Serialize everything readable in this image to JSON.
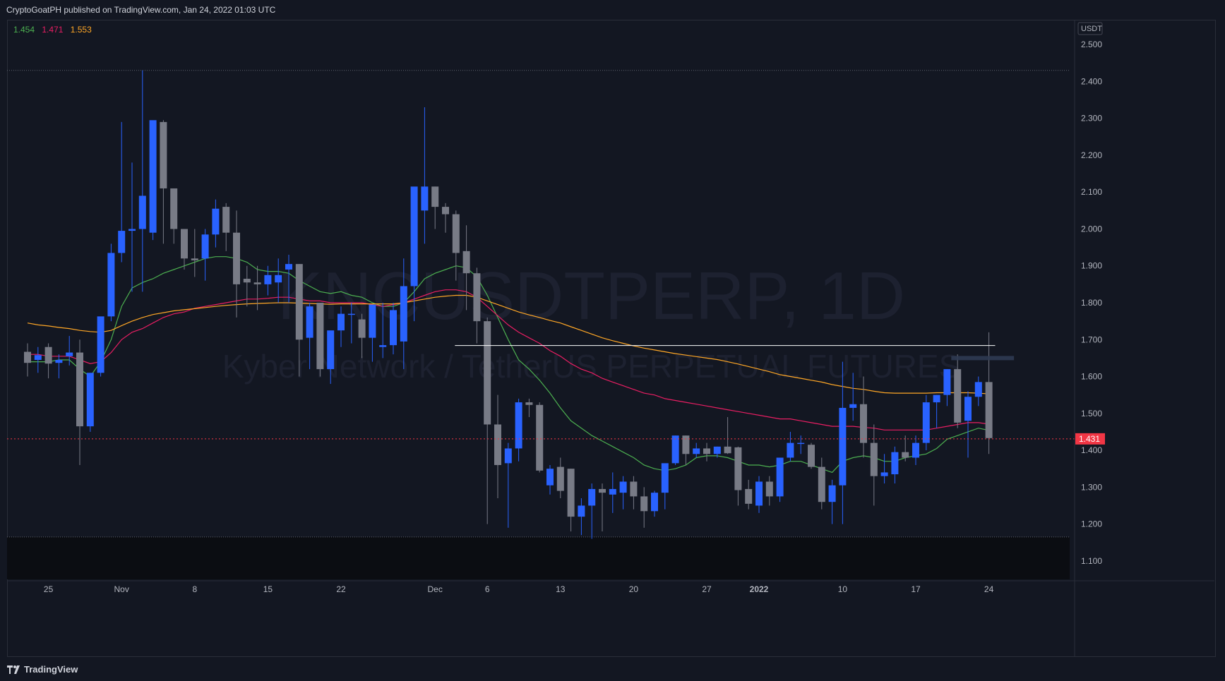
{
  "header": {
    "published_text": "CryptoGoatPH published on TradingView.com, Jan 24, 2022 01:03 UTC"
  },
  "footer": {
    "logo_text": "TradingView"
  },
  "legend": {
    "ma_fast": {
      "value": "1.454",
      "color": "#4caf50"
    },
    "ma_mid": {
      "value": "1.471",
      "color": "#e91e63"
    },
    "ma_slow": {
      "value": "1.553",
      "color": "#ffa726"
    }
  },
  "watermark": {
    "symbol": "KNCUSDTPERP, 1D",
    "description": "Kyber Network / TetherUS PERPETUAL FUTURES"
  },
  "price_axis": {
    "currency": "USDT",
    "last_price": "1.431"
  },
  "colors": {
    "up": "#2962ff",
    "down": "#787b86",
    "last_price_line": "#f23645",
    "background": "#131722"
  },
  "chart_data": {
    "type": "candlestick",
    "symbol": "KNCUSDTPERP",
    "interval": "1D",
    "ylim": [
      1.05,
      2.55
    ],
    "y_ticks": [
      "2.500",
      "2.400",
      "2.300",
      "2.200",
      "2.100",
      "2.000",
      "1.900",
      "1.800",
      "1.700",
      "1.600",
      "1.500",
      "1.400",
      "1.300",
      "1.200",
      "1.100"
    ],
    "x_ticks": [
      {
        "label": "25",
        "index": 2
      },
      {
        "label": "Nov",
        "index": 9
      },
      {
        "label": "8",
        "index": 16
      },
      {
        "label": "15",
        "index": 23
      },
      {
        "label": "22",
        "index": 30
      },
      {
        "label": "Dec",
        "index": 39
      },
      {
        "label": "6",
        "index": 44
      },
      {
        "label": "13",
        "index": 51
      },
      {
        "label": "20",
        "index": 58
      },
      {
        "label": "27",
        "index": 65
      },
      {
        "label": "2022",
        "index": 70
      },
      {
        "label": "10",
        "index": 78
      },
      {
        "label": "17",
        "index": 85
      },
      {
        "label": "24",
        "index": 92
      }
    ],
    "candles": [
      [
        1.667,
        1.69,
        1.6,
        1.637
      ],
      [
        1.645,
        1.68,
        1.61,
        1.658
      ],
      [
        1.68,
        1.69,
        1.595,
        1.635
      ],
      [
        1.637,
        1.66,
        1.595,
        1.645
      ],
      [
        1.655,
        1.71,
        1.63,
        1.665
      ],
      [
        1.665,
        1.7,
        1.36,
        1.465
      ],
      [
        1.465,
        1.61,
        1.45,
        1.61
      ],
      [
        1.61,
        1.71,
        1.6,
        1.763
      ],
      [
        1.763,
        1.96,
        1.75,
        1.935
      ],
      [
        1.935,
        2.29,
        1.91,
        1.995
      ],
      [
        1.995,
        2.18,
        1.83,
        2.0
      ],
      [
        2.0,
        2.43,
        1.83,
        2.09
      ],
      [
        1.99,
        2.29,
        1.97,
        2.295
      ],
      [
        2.29,
        2.295,
        1.96,
        2.11
      ],
      [
        2.11,
        2.11,
        1.96,
        2.0
      ],
      [
        2.0,
        2.0,
        1.89,
        1.92
      ],
      [
        1.92,
        2.0,
        1.87,
        1.915
      ],
      [
        1.92,
        2.0,
        1.86,
        1.985
      ],
      [
        1.985,
        2.08,
        1.95,
        2.055
      ],
      [
        2.06,
        2.07,
        1.94,
        1.99
      ],
      [
        1.99,
        2.05,
        1.76,
        1.85
      ],
      [
        1.865,
        1.9,
        1.79,
        1.855
      ],
      [
        1.855,
        1.9,
        1.78,
        1.85
      ],
      [
        1.85,
        1.9,
        1.82,
        1.875
      ],
      [
        1.855,
        1.92,
        1.8,
        1.875
      ],
      [
        1.89,
        1.93,
        1.8,
        1.905
      ],
      [
        1.905,
        1.905,
        1.6,
        1.7
      ],
      [
        1.705,
        1.8,
        1.62,
        1.79
      ],
      [
        1.8,
        1.8,
        1.6,
        1.62
      ],
      [
        1.62,
        1.72,
        1.58,
        1.725
      ],
      [
        1.725,
        1.79,
        1.68,
        1.77
      ],
      [
        1.77,
        1.8,
        1.69,
        1.77
      ],
      [
        1.755,
        1.77,
        1.65,
        1.705
      ],
      [
        1.705,
        1.76,
        1.64,
        1.795
      ],
      [
        1.68,
        1.8,
        1.65,
        1.685
      ],
      [
        1.685,
        1.8,
        1.66,
        1.78
      ],
      [
        1.695,
        1.92,
        1.62,
        1.845
      ],
      [
        1.845,
        2.1,
        1.75,
        2.115
      ],
      [
        2.05,
        2.33,
        1.96,
        2.115
      ],
      [
        2.115,
        2.115,
        2.0,
        2.06
      ],
      [
        2.06,
        2.07,
        1.99,
        2.04
      ],
      [
        2.04,
        2.05,
        1.86,
        1.935
      ],
      [
        1.94,
        2.01,
        1.78,
        1.88
      ],
      [
        1.88,
        1.895,
        1.69,
        1.75
      ],
      [
        1.75,
        1.76,
        1.2,
        1.47
      ],
      [
        1.47,
        1.55,
        1.27,
        1.36
      ],
      [
        1.365,
        1.42,
        1.19,
        1.405
      ],
      [
        1.405,
        1.54,
        1.37,
        1.53
      ],
      [
        1.53,
        1.54,
        1.49,
        1.523
      ],
      [
        1.523,
        1.53,
        1.34,
        1.345
      ],
      [
        1.305,
        1.36,
        1.28,
        1.35
      ],
      [
        1.355,
        1.38,
        1.27,
        1.29
      ],
      [
        1.35,
        1.35,
        1.18,
        1.22
      ],
      [
        1.22,
        1.27,
        1.17,
        1.25
      ],
      [
        1.25,
        1.31,
        1.16,
        1.295
      ],
      [
        1.295,
        1.31,
        1.18,
        1.285
      ],
      [
        1.28,
        1.34,
        1.23,
        1.295
      ],
      [
        1.285,
        1.33,
        1.24,
        1.315
      ],
      [
        1.315,
        1.33,
        1.24,
        1.275
      ],
      [
        1.275,
        1.3,
        1.19,
        1.235
      ],
      [
        1.235,
        1.29,
        1.22,
        1.285
      ],
      [
        1.285,
        1.36,
        1.24,
        1.365
      ],
      [
        1.365,
        1.44,
        1.36,
        1.44
      ],
      [
        1.44,
        1.44,
        1.36,
        1.39
      ],
      [
        1.39,
        1.42,
        1.38,
        1.405
      ],
      [
        1.405,
        1.42,
        1.37,
        1.39
      ],
      [
        1.39,
        1.41,
        1.38,
        1.41
      ],
      [
        1.41,
        1.49,
        1.39,
        1.392
      ],
      [
        1.408,
        1.41,
        1.25,
        1.292
      ],
      [
        1.295,
        1.32,
        1.24,
        1.255
      ],
      [
        1.25,
        1.33,
        1.23,
        1.315
      ],
      [
        1.315,
        1.33,
        1.25,
        1.275
      ],
      [
        1.275,
        1.37,
        1.26,
        1.38
      ],
      [
        1.38,
        1.45,
        1.37,
        1.42
      ],
      [
        1.42,
        1.44,
        1.39,
        1.42
      ],
      [
        1.415,
        1.42,
        1.35,
        1.355
      ],
      [
        1.355,
        1.38,
        1.24,
        1.26
      ],
      [
        1.26,
        1.32,
        1.2,
        1.305
      ],
      [
        1.305,
        1.64,
        1.2,
        1.515
      ],
      [
        1.515,
        1.61,
        1.48,
        1.525
      ],
      [
        1.525,
        1.6,
        1.38,
        1.42
      ],
      [
        1.42,
        1.47,
        1.25,
        1.33
      ],
      [
        1.33,
        1.39,
        1.31,
        1.34
      ],
      [
        1.335,
        1.41,
        1.31,
        1.395
      ],
      [
        1.395,
        1.44,
        1.37,
        1.38
      ],
      [
        1.38,
        1.44,
        1.36,
        1.42
      ],
      [
        1.42,
        1.55,
        1.4,
        1.53
      ],
      [
        1.53,
        1.55,
        1.46,
        1.55
      ],
      [
        1.55,
        1.62,
        1.52,
        1.62
      ],
      [
        1.62,
        1.66,
        1.46,
        1.475
      ],
      [
        1.48,
        1.56,
        1.38,
        1.545
      ],
      [
        1.545,
        1.6,
        1.52,
        1.585
      ],
      [
        1.585,
        1.72,
        1.39,
        1.433
      ]
    ],
    "moving_averages": [
      {
        "name": "1.454",
        "color": "#4caf50",
        "values": [
          1.64,
          1.64,
          1.64,
          1.645,
          1.645,
          1.62,
          1.6,
          1.64,
          1.7,
          1.79,
          1.84,
          1.855,
          1.865,
          1.88,
          1.89,
          1.9,
          1.91,
          1.92,
          1.925,
          1.925,
          1.92,
          1.91,
          1.89,
          1.885,
          1.885,
          1.88,
          1.86,
          1.845,
          1.83,
          1.825,
          1.83,
          1.82,
          1.815,
          1.8,
          1.79,
          1.79,
          1.8,
          1.83,
          1.865,
          1.88,
          1.89,
          1.9,
          1.895,
          1.87,
          1.82,
          1.76,
          1.7,
          1.645,
          1.62,
          1.59,
          1.555,
          1.515,
          1.48,
          1.46,
          1.44,
          1.425,
          1.41,
          1.395,
          1.38,
          1.36,
          1.35,
          1.345,
          1.35,
          1.36,
          1.38,
          1.385,
          1.385,
          1.38,
          1.37,
          1.36,
          1.36,
          1.355,
          1.36,
          1.37,
          1.37,
          1.36,
          1.35,
          1.34,
          1.37,
          1.38,
          1.385,
          1.38,
          1.37,
          1.37,
          1.38,
          1.385,
          1.39,
          1.405,
          1.43,
          1.44,
          1.45,
          1.46,
          1.454
        ]
      },
      {
        "name": "1.471",
        "color": "#e91e63",
        "values": [
          1.66,
          1.66,
          1.655,
          1.655,
          1.655,
          1.645,
          1.635,
          1.64,
          1.665,
          1.7,
          1.72,
          1.73,
          1.745,
          1.76,
          1.77,
          1.775,
          1.785,
          1.79,
          1.795,
          1.8,
          1.805,
          1.81,
          1.81,
          1.812,
          1.815,
          1.815,
          1.81,
          1.805,
          1.805,
          1.8,
          1.8,
          1.8,
          1.8,
          1.795,
          1.79,
          1.795,
          1.8,
          1.81,
          1.82,
          1.83,
          1.835,
          1.835,
          1.83,
          1.815,
          1.79,
          1.765,
          1.74,
          1.72,
          1.705,
          1.69,
          1.67,
          1.655,
          1.635,
          1.62,
          1.61,
          1.595,
          1.585,
          1.575,
          1.565,
          1.555,
          1.55,
          1.54,
          1.535,
          1.53,
          1.525,
          1.52,
          1.515,
          1.51,
          1.505,
          1.5,
          1.495,
          1.49,
          1.485,
          1.485,
          1.48,
          1.475,
          1.47,
          1.465,
          1.465,
          1.465,
          1.462,
          1.46,
          1.455,
          1.455,
          1.455,
          1.455,
          1.455,
          1.46,
          1.465,
          1.47,
          1.475,
          1.475,
          1.471
        ]
      },
      {
        "name": "1.553",
        "color": "#ffa726",
        "values": [
          1.745,
          1.74,
          1.737,
          1.733,
          1.73,
          1.725,
          1.722,
          1.72,
          1.725,
          1.738,
          1.75,
          1.76,
          1.768,
          1.773,
          1.778,
          1.781,
          1.784,
          1.787,
          1.79,
          1.793,
          1.795,
          1.797,
          1.798,
          1.799,
          1.8,
          1.8,
          1.799,
          1.798,
          1.797,
          1.796,
          1.797,
          1.797,
          1.797,
          1.797,
          1.797,
          1.797,
          1.8,
          1.805,
          1.81,
          1.815,
          1.818,
          1.82,
          1.82,
          1.815,
          1.805,
          1.795,
          1.785,
          1.775,
          1.767,
          1.76,
          1.752,
          1.745,
          1.735,
          1.725,
          1.715,
          1.705,
          1.697,
          1.69,
          1.683,
          1.677,
          1.672,
          1.667,
          1.662,
          1.658,
          1.654,
          1.65,
          1.646,
          1.64,
          1.634,
          1.627,
          1.62,
          1.613,
          1.605,
          1.6,
          1.595,
          1.59,
          1.585,
          1.578,
          1.573,
          1.568,
          1.565,
          1.56,
          1.556,
          1.555,
          1.555,
          1.555,
          1.555,
          1.556,
          1.556,
          1.556,
          1.556,
          1.555,
          1.553
        ]
      }
    ],
    "annotations": {
      "horizontal_line_price": 1.684,
      "recent_high_level": 1.65
    },
    "current_price": 1.431
  }
}
